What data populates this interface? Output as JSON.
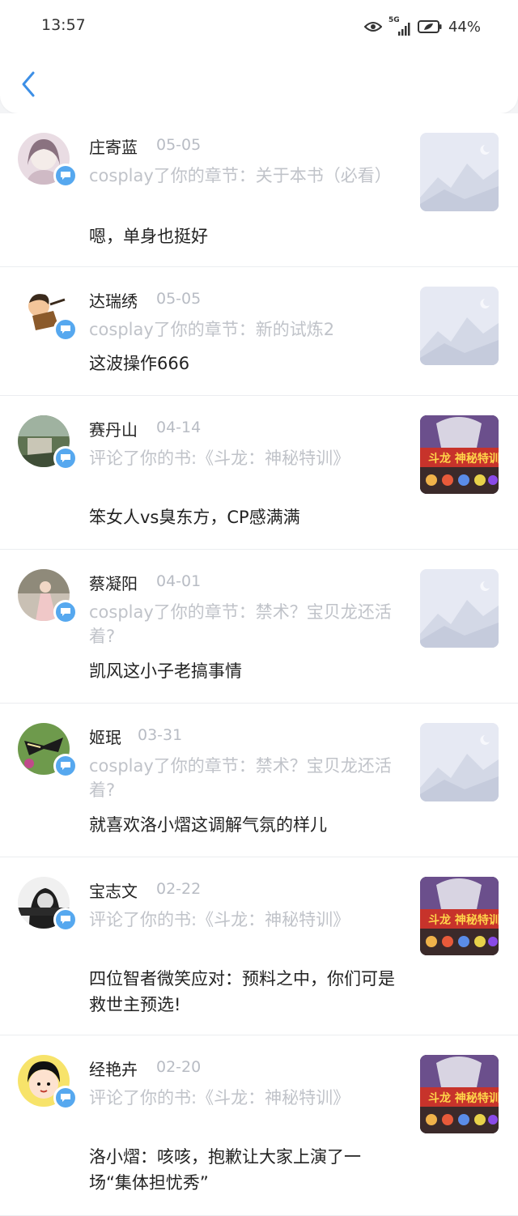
{
  "status": {
    "time": "13:57",
    "network": "5G",
    "battery": "44%"
  },
  "colors": {
    "accent": "#56a8ef",
    "date_gray": "#b8bcc4",
    "action_gray": "#c0c3c9"
  },
  "items": [
    {
      "name": "庄寄蓝",
      "date": "05-05",
      "action": "cosplay了你的章节：关于本书（必看）",
      "comment": "嗯，单身也挺好",
      "thumb": "placeholder-mountain"
    },
    {
      "name": "达瑞绣",
      "date": "05-05",
      "action": "cosplay了你的章节：新的试炼2",
      "comment": "这波操作666",
      "thumb": "placeholder-mountain"
    },
    {
      "name": "赛丹山",
      "date": "04-14",
      "action": "评论了你的书:《斗龙：神秘特训》",
      "comment": "笨女人vs臭东方，CP感满满",
      "thumb": "book-cover"
    },
    {
      "name": "蔡凝阳",
      "date": "04-01",
      "action": "cosplay了你的章节：禁术？宝贝龙还活着?",
      "comment": "凯风这小子老搞事情",
      "thumb": "placeholder-mountain"
    },
    {
      "name": "姬珉",
      "date": "03-31",
      "action": "cosplay了你的章节：禁术？宝贝龙还活着?",
      "comment": "就喜欢洛小熠这调解气氛的样儿",
      "thumb": "placeholder-mountain"
    },
    {
      "name": "宝志文",
      "date": "02-22",
      "action": "评论了你的书:《斗龙：神秘特训》",
      "comment": "四位智者微笑应对：预料之中，你们可是救世主预选!",
      "thumb": "book-cover"
    },
    {
      "name": "经艳卉",
      "date": "02-20",
      "action": "评论了你的书:《斗龙：神秘特训》",
      "comment": "洛小熠：咳咳，抱歉让大家上演了一场“集体担忧秀”",
      "thumb": "book-cover"
    }
  ]
}
